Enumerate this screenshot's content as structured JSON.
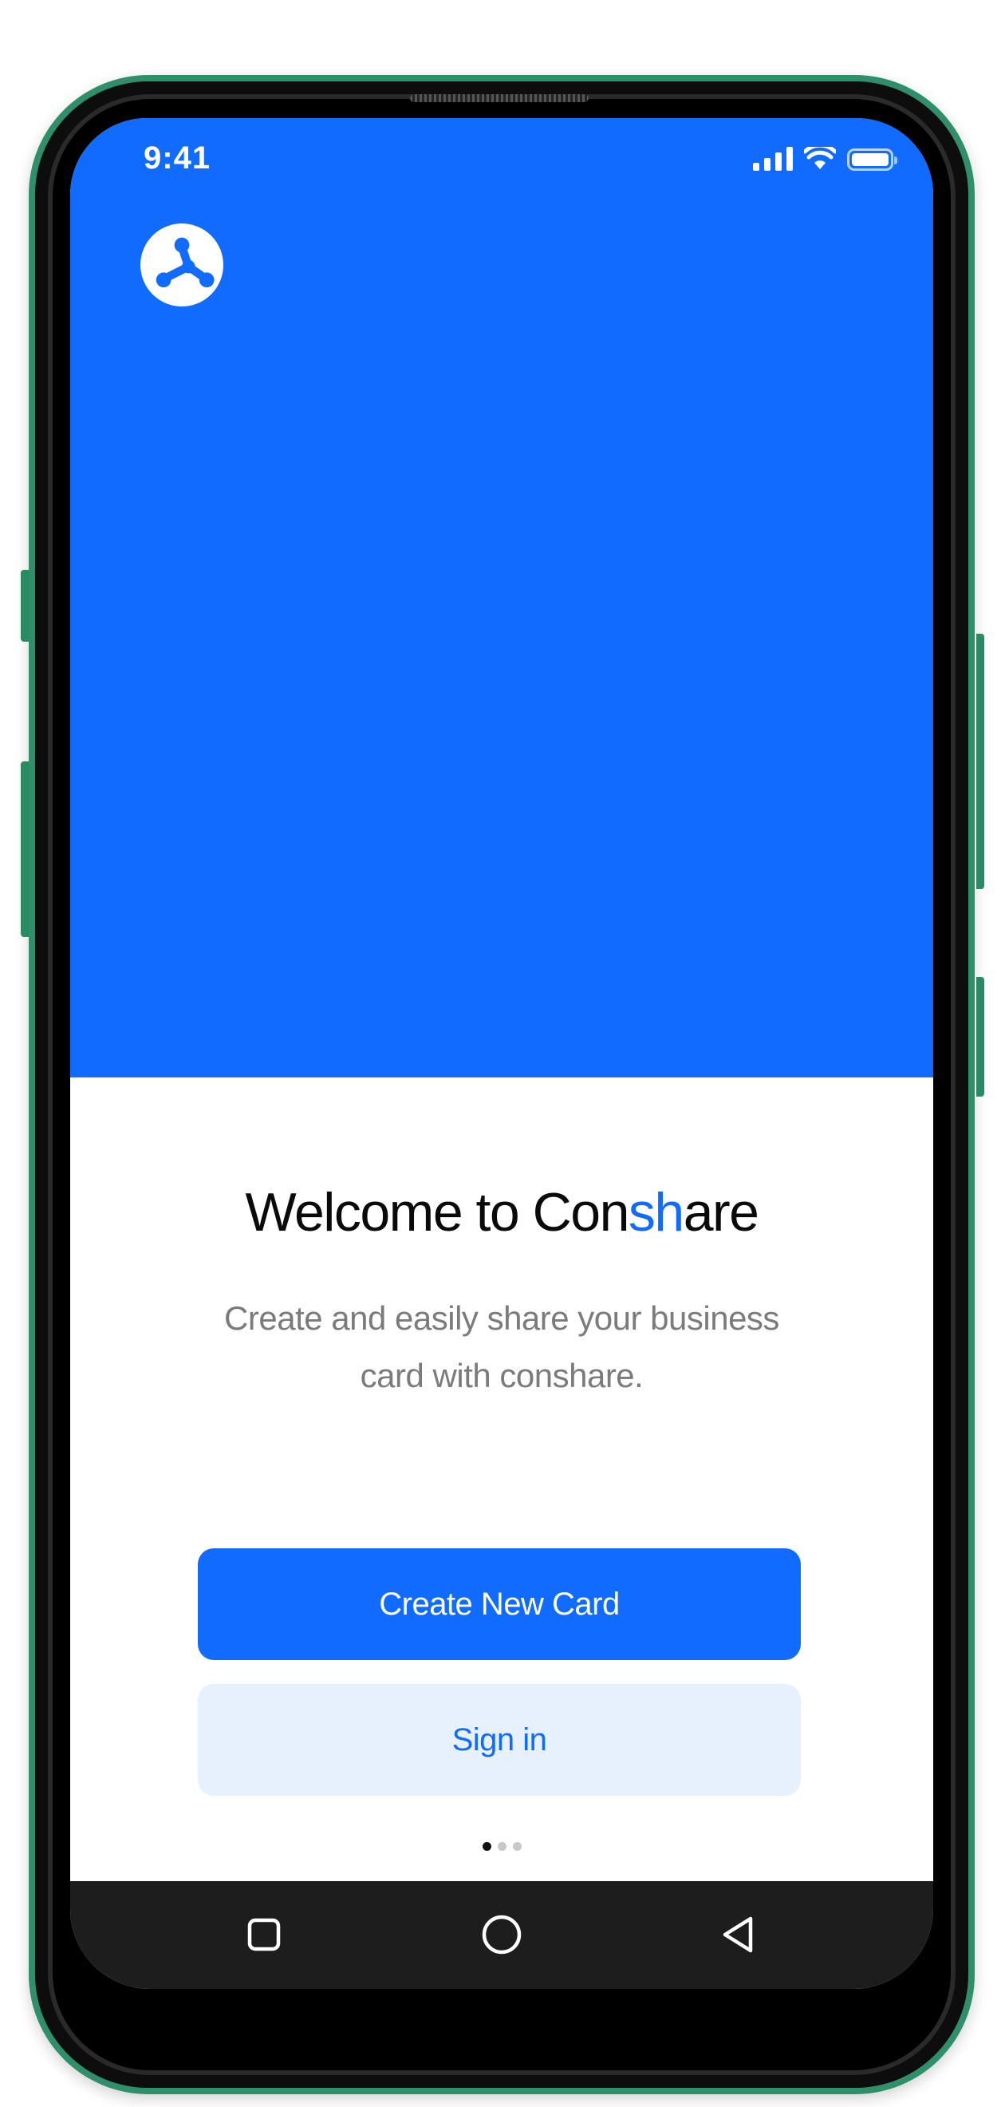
{
  "status_bar": {
    "time": "9:41",
    "icons": [
      "signal-icon",
      "wifi-icon",
      "battery-icon"
    ]
  },
  "app": {
    "logo_icon": "conshare-logo-icon",
    "brand_color": "#116bfe",
    "secondary_bg": "#e6f1fd"
  },
  "welcome": {
    "title_part1": "Welcome to Con",
    "title_accent": "sh",
    "title_part2": "are",
    "subtitle": "Create and easily share your business card with conshare."
  },
  "buttons": {
    "create_label": "Create New Card",
    "signin_label": "Sign in"
  },
  "pagination": {
    "total": 3,
    "active_index": 0
  },
  "navbar": {
    "icons": [
      "recent-apps-icon",
      "home-icon",
      "back-icon"
    ]
  }
}
